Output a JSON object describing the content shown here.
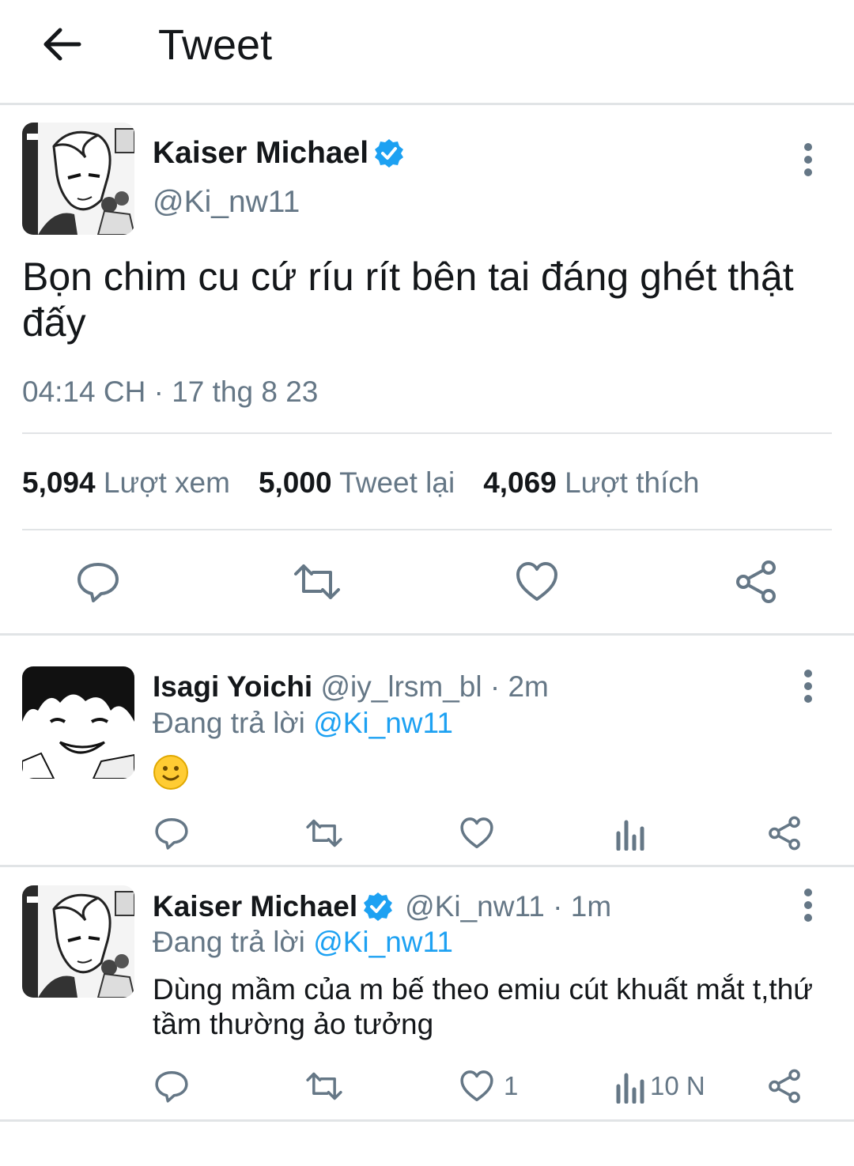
{
  "header": {
    "title": "Tweet"
  },
  "main_tweet": {
    "name": "Kaiser Michael",
    "handle": "@Ki_nw11",
    "text": "Bọn chim cu cứ ríu rít bên tai đáng ghét thật đấy",
    "timestamp": "04:14 CH · 17 thg 8 23",
    "stats": {
      "views_count": "5,094",
      "views_label": "Lượt xem",
      "retweets_count": "5,000",
      "retweets_label": "Tweet lại",
      "likes_count": "4,069",
      "likes_label": "Lượt thích"
    }
  },
  "replies": [
    {
      "name": "Isagi Yoichi",
      "handle": "@iy_lrsm_bl",
      "time": "· 2m",
      "replying_prefix": "Đang trả lời",
      "replying_to": "@Ki_nw11",
      "text": "🙂",
      "like_count": "",
      "views": ""
    },
    {
      "name": "Kaiser Michael",
      "handle": "@Ki_nw11",
      "time": "· 1m",
      "replying_prefix": "Đang trả lời",
      "replying_to": "@Ki_nw11",
      "text": "Dùng mầm của m bế theo emiu cút khuất mắt t,thứ tầm thường ảo tưởng",
      "like_count": "1",
      "views": "10 N"
    }
  ],
  "colors": {
    "accent": "#1da1f2",
    "muted": "#657786",
    "divider": "#e1e4e6"
  },
  "icons": [
    "back-arrow-icon",
    "verified-badge-icon",
    "more-vertical-icon",
    "reply-icon",
    "retweet-icon",
    "like-icon",
    "share-icon",
    "analytics-icon",
    "smiley-emoji-icon"
  ]
}
